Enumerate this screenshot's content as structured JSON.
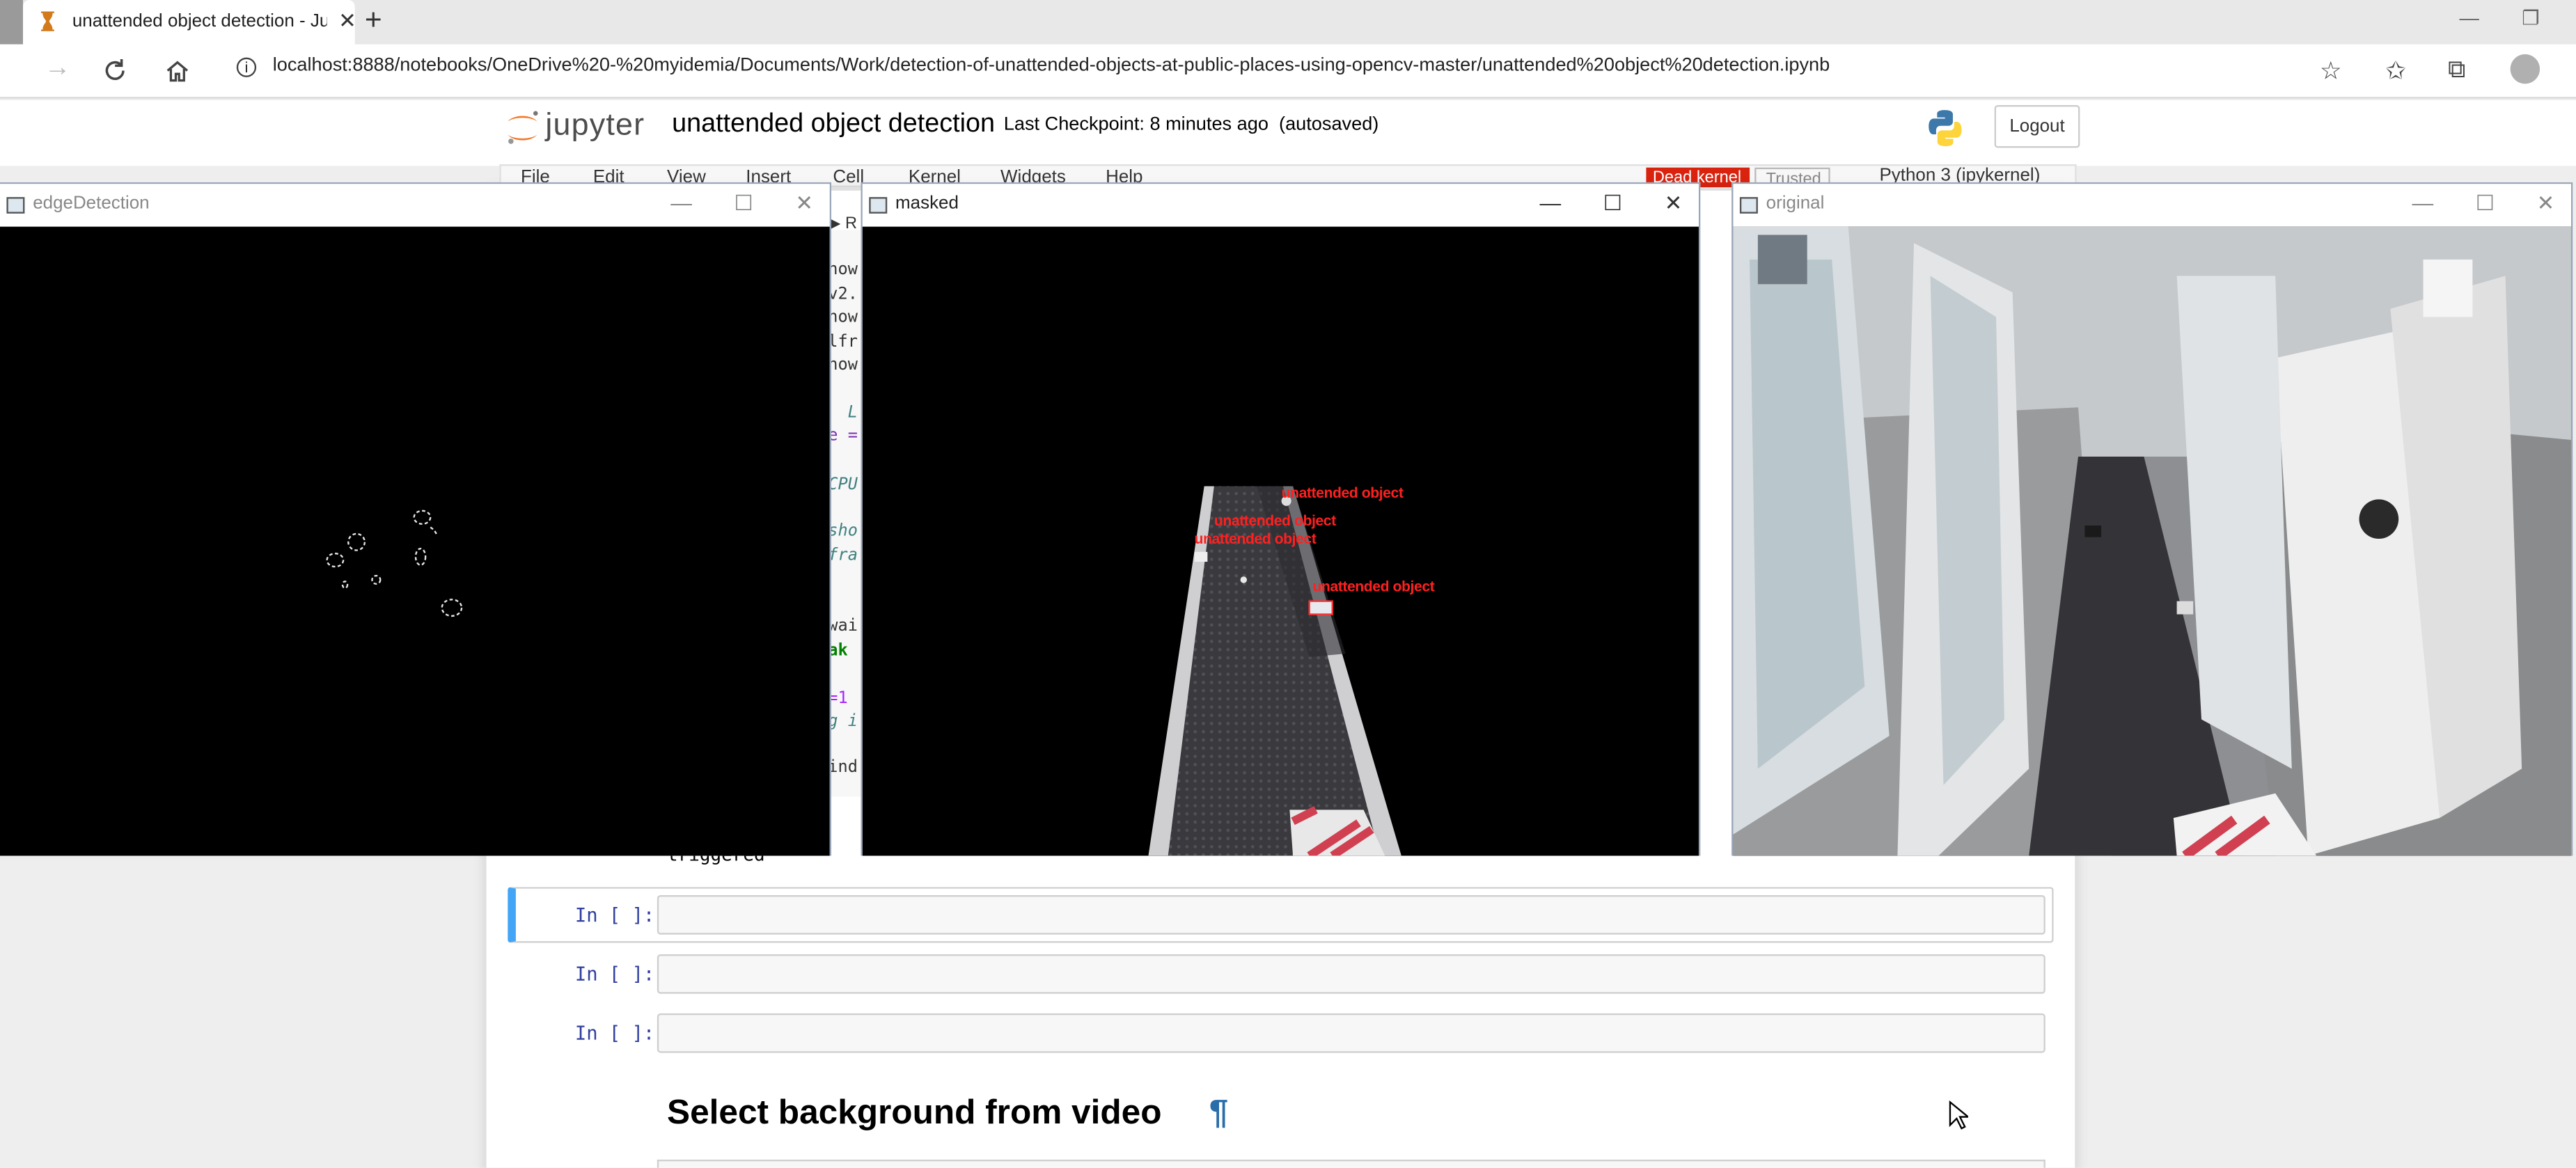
{
  "browser": {
    "tab_title": "unattended object detection - Ju",
    "tab_close": "✕",
    "new_tab": "+",
    "url": "localhost:8888/notebooks/OneDrive%20-%20myidemia/Documents/Work/detection-of-unattended-objects-at-public-places-using-opencv-master/unattended%20object%20detection.ipynb",
    "icons": [
      "back-icon",
      "forward-icon",
      "reload-icon",
      "home-icon",
      "info-icon",
      "add-favorite-icon",
      "favorites-icon",
      "collections-icon",
      "profile-icon",
      "minimize-icon",
      "restore-icon"
    ]
  },
  "jupyter": {
    "logo_text": "jupyter",
    "notebook_name": "unattended object detection",
    "checkpoint": "Last Checkpoint: 8 minutes ago",
    "autosaved": "(autosaved)",
    "logout": "Logout",
    "menu": [
      "File",
      "Edit",
      "View",
      "Insert",
      "Cell",
      "Kernel",
      "Widgets",
      "Help"
    ],
    "dead_kernel": "Dead kernel",
    "trusted": "Trusted",
    "kernel_name": "Python 3 (ipykernel)",
    "run_label": "R",
    "code_fragments": [
      "how",
      "v2.",
      "how",
      "lfr",
      "how",
      "L",
      "e =",
      "CPU",
      "sho",
      "fra",
      "wai",
      "ak",
      "=1",
      "g i",
      "ind"
    ],
    "output_text": "triggered",
    "prompts": [
      "In [ ]:",
      "In [ ]:",
      "In [ ]:"
    ],
    "heading": "Select background from video",
    "pilcrow": "¶"
  },
  "windows": {
    "edge": {
      "title": "edgeDetection"
    },
    "masked": {
      "title": "masked",
      "labels": [
        "unattended object",
        "unattended object",
        "unattended object",
        "unattended object"
      ]
    },
    "original": {
      "title": "original"
    },
    "controls": {
      "min": "—",
      "max": "☐",
      "close": "✕"
    }
  }
}
